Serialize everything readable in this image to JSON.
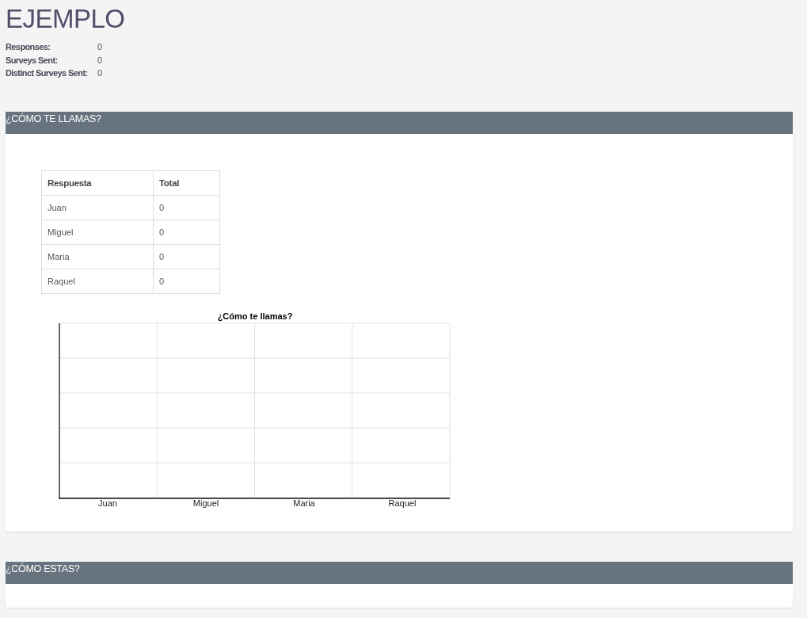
{
  "title": "EJEMPLO",
  "stats": [
    {
      "label": "Responses:",
      "value": "0"
    },
    {
      "label": "Surveys Sent:",
      "value": "0"
    },
    {
      "label": "Distinct Surveys Sent:",
      "value": "0"
    }
  ],
  "questions": [
    {
      "heading": "¿CÓMO TE LLAMAS?",
      "table": {
        "columns": [
          "Respuesta",
          "Total"
        ],
        "rows": [
          [
            "Juan",
            "0"
          ],
          [
            "Miguel",
            "0"
          ],
          [
            "Maria",
            "0"
          ],
          [
            "Raquel",
            "0"
          ]
        ]
      },
      "chart": {
        "title": "¿Cómo te llamas?",
        "categories": [
          "Juan",
          "Miguel",
          "Maria",
          "Raquel"
        ]
      }
    },
    {
      "heading": "¿CÓMO ESTAS?"
    }
  ]
}
